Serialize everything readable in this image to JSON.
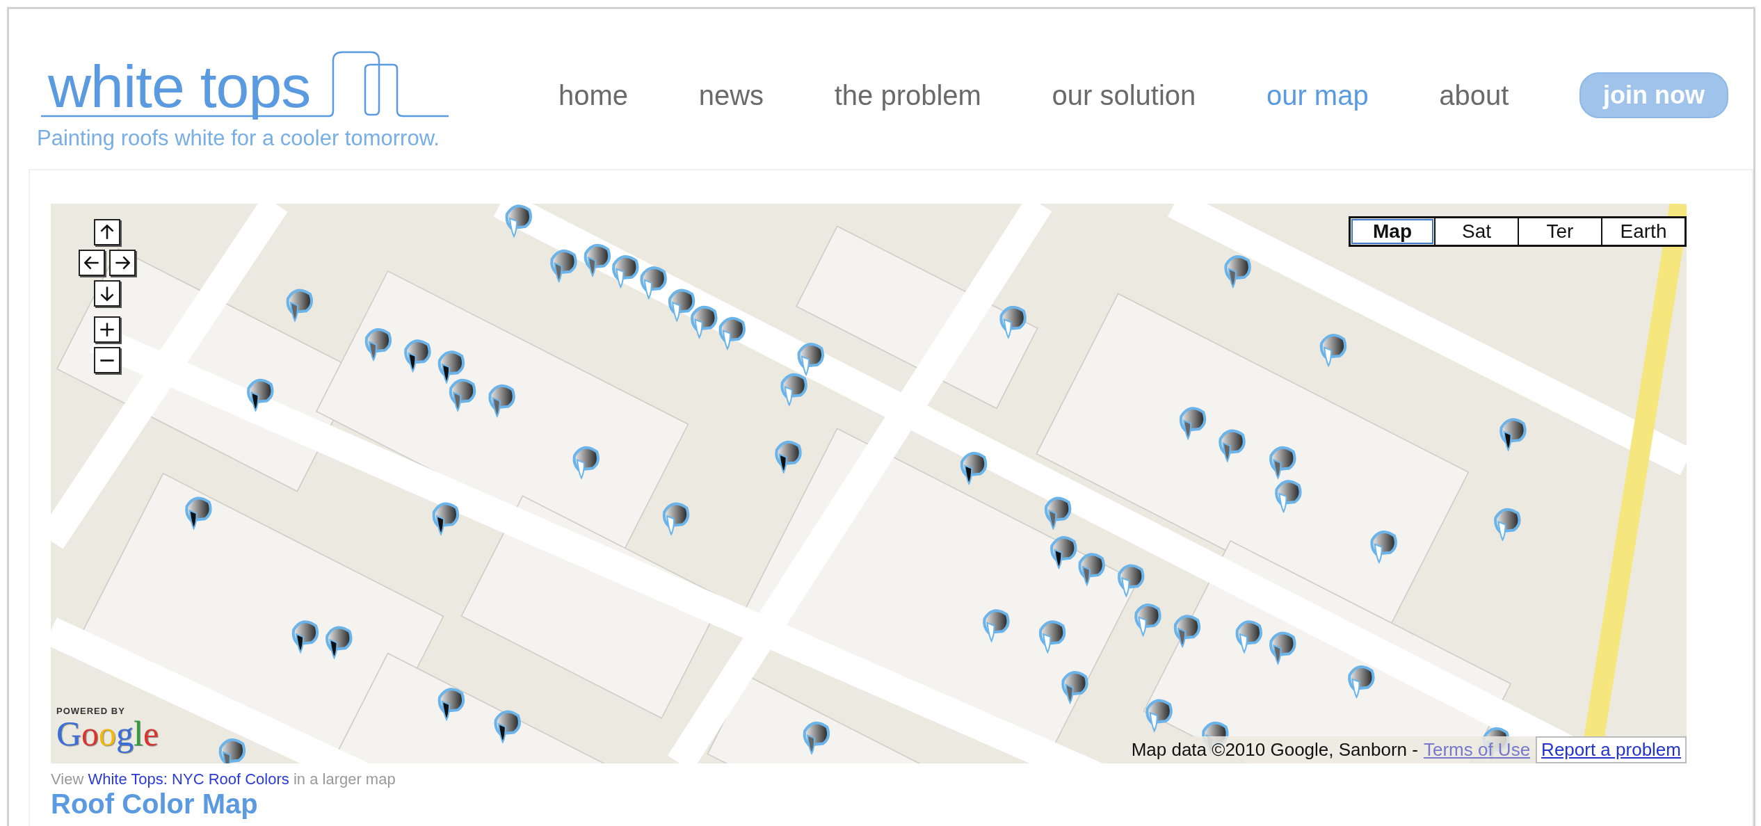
{
  "logo": {
    "name": "white tops",
    "tagline": "Painting roofs white for a cooler tomorrow."
  },
  "nav": [
    {
      "label": "home",
      "selected": false
    },
    {
      "label": "news",
      "selected": false
    },
    {
      "label": "the problem",
      "selected": false
    },
    {
      "label": "our solution",
      "selected": false
    },
    {
      "label": "our map",
      "selected": true
    },
    {
      "label": "about",
      "selected": false
    }
  ],
  "join_button": "join now",
  "map": {
    "map_types": [
      {
        "label": "Map",
        "selected": true
      },
      {
        "label": "Sat",
        "selected": false
      },
      {
        "label": "Ter",
        "selected": false
      },
      {
        "label": "Earth",
        "selected": false
      }
    ],
    "powered_by": "POWERED BY",
    "google_logo": "Google",
    "attribution": "Map data ©2010 Google, Sanborn -",
    "terms_link": "Terms of Use",
    "report_link": "Report a problem"
  },
  "view_link": {
    "prefix": "View",
    "link": "White Tops: NYC Roof Colors",
    "suffix": "in a larger map"
  },
  "heading": "Roof Color Map"
}
